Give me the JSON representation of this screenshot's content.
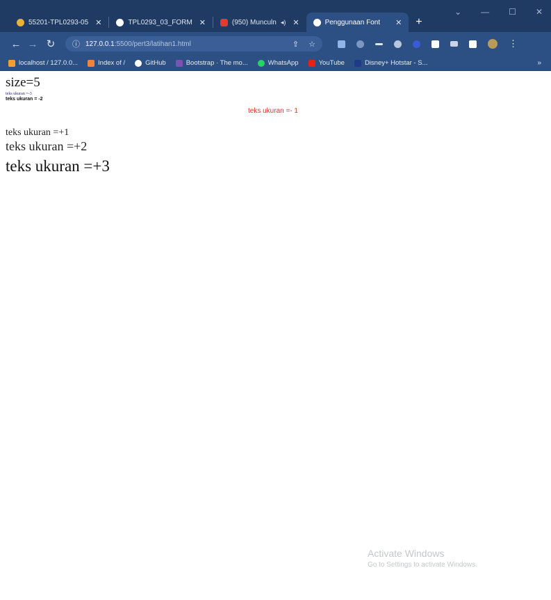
{
  "browser": {
    "tabs": [
      {
        "label": "55201-TPL0293-05",
        "favicon_color": "#e8b23a"
      },
      {
        "label": "TPL0293_03_FORM",
        "favicon_color": "#ffffff"
      },
      {
        "label": "(950) Munculn",
        "favicon_color": "#e23b2e"
      },
      {
        "label": "Penggunaan Font",
        "favicon_color": "#ffffff"
      }
    ],
    "url_host": "127.0.0.1",
    "url_rest": ":5500/pert3/latihan1.html",
    "bookmarks": [
      {
        "label": "localhost / 127.0.0...",
        "icon_color": "#f0a030"
      },
      {
        "label": "Index of /",
        "icon_color": "#f2843a"
      },
      {
        "label": "GitHub",
        "icon_color": "#ffffff"
      },
      {
        "label": "Bootstrap · The mo...",
        "icon_color": "#7952b3"
      },
      {
        "label": "WhatsApp",
        "icon_color": "#25d366"
      },
      {
        "label": "YouTube",
        "icon_color": "#e62117"
      },
      {
        "label": "Disney+ Hotstar - S...",
        "icon_color": "#1f3a8a"
      }
    ],
    "more_bookmarks": "»"
  },
  "content": {
    "size5": "size=5",
    "minus3": "teks ukuran =-3",
    "minus2": "teks ukuran = -2",
    "minus1": "teks ukuran =- 1",
    "plus1": "teks ukuran =+1",
    "plus2": "teks ukuran =+2",
    "plus3": "teks ukuran =+3"
  },
  "watermark": {
    "line1": "Activate Windows",
    "line2": "Go to Settings to activate Windows."
  }
}
